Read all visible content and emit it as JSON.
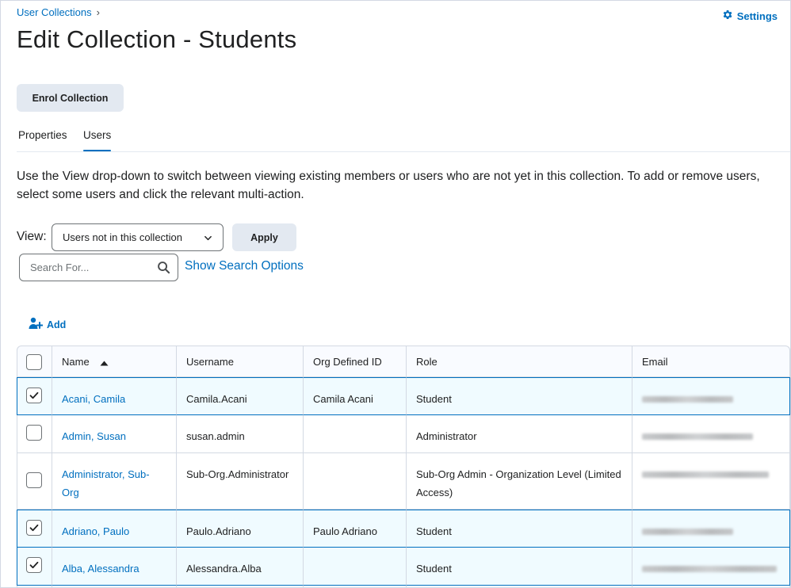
{
  "breadcrumb": {
    "items": [
      "User Collections"
    ],
    "separator": "›"
  },
  "header": {
    "settings_label": "Settings",
    "title": "Edit Collection - Students"
  },
  "actions": {
    "enrol_label": "Enrol Collection"
  },
  "tabs": [
    {
      "label": "Properties",
      "active": false
    },
    {
      "label": "Users",
      "active": true
    }
  ],
  "description": "Use the View drop-down to switch between viewing existing members or users who are not yet in this collection. To add or remove users, select some users and click the relevant multi-action.",
  "view": {
    "label": "View:",
    "selected": "Users not in this collection",
    "apply_label": "Apply"
  },
  "search": {
    "placeholder": "Search For...",
    "options_link": "Show Search Options"
  },
  "toolbar": {
    "add_label": "Add"
  },
  "table": {
    "columns": [
      "Name",
      "Username",
      "Org Defined ID",
      "Role",
      "Email"
    ],
    "sort_column": "Name",
    "sort_direction": "ascending",
    "rows": [
      {
        "checked": true,
        "name": "Acani, Camila",
        "username": "Camila.Acani",
        "org_id": "Camila Acani",
        "role": "Student"
      },
      {
        "checked": false,
        "name": "Admin, Susan",
        "username": "susan.admin",
        "org_id": "",
        "role": "Administrator"
      },
      {
        "checked": false,
        "name": "Administrator, Sub-Org",
        "username": "Sub-Org.Administrator",
        "org_id": "",
        "role": "Sub-Org Admin - Organization Level (Limited Access)"
      },
      {
        "checked": true,
        "name": "Adriano, Paulo",
        "username": "Paulo.Adriano",
        "org_id": "Paulo Adriano",
        "role": "Student"
      },
      {
        "checked": true,
        "name": "Alba, Alessandra",
        "username": "Alessandra.Alba",
        "org_id": "",
        "role": "Student"
      }
    ]
  },
  "colors": {
    "link": "#006fbf",
    "button_bg": "#e3e9f1",
    "selected_row_bg": "#f0fbff",
    "border": "#d3d9e3"
  }
}
